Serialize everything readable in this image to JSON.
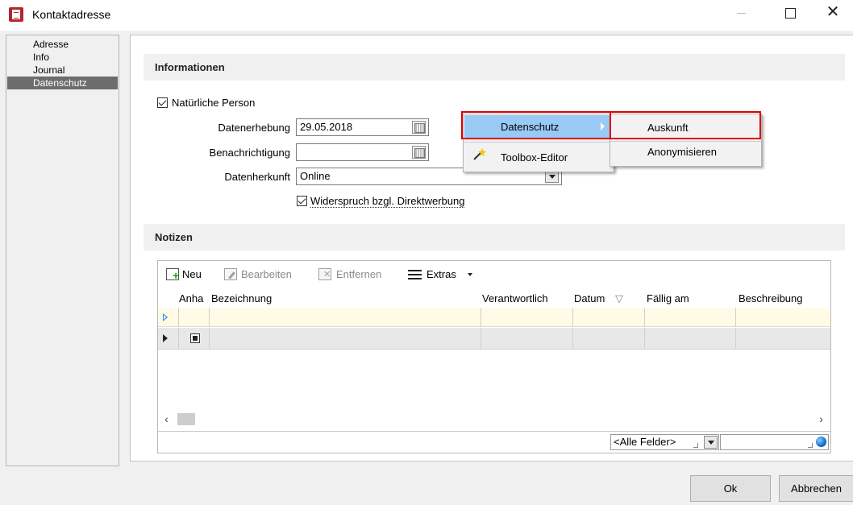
{
  "window": {
    "title": "Kontaktadresse",
    "minimize_label": "",
    "maximize_label": "",
    "close_label": "✕"
  },
  "nav": {
    "items": [
      {
        "label": "Adresse"
      },
      {
        "label": "Info"
      },
      {
        "label": "Journal"
      },
      {
        "label": "Datenschutz",
        "active": true
      }
    ]
  },
  "info_section": {
    "header": "Informationen",
    "natural_person_label": "Natürliche Person",
    "natural_person_checked": true,
    "data_collection_label": "Datenerhebung",
    "data_collection_value": "29.05.2018",
    "notification_label": "Benachrichtigung",
    "notification_value": "",
    "data_origin_label": "Datenherkunft",
    "data_origin_value": "Online",
    "objection_label": "Widerspruch bzgl. Direktwerbung",
    "objection_checked": true
  },
  "context_menu": {
    "items": [
      {
        "label": "Datenschutz",
        "highlighted": true,
        "has_submenu": true
      },
      {
        "label": "Toolbox-Editor",
        "icon": "magic-wand-icon"
      }
    ],
    "submenu": [
      {
        "label": "Auskunft",
        "highlighted": true
      },
      {
        "label": "Anonymisieren"
      }
    ],
    "highlight_color": "#e00000",
    "selection_color": "#99c9f5"
  },
  "notes_section": {
    "header": "Notizen",
    "toolbar": {
      "new_label": "Neu",
      "edit_label": "Bearbeiten",
      "remove_label": "Entfernen",
      "extras_label": "Extras"
    },
    "columns": [
      "Anha",
      "Bezeichnung",
      "Verantwortlich",
      "Datum",
      "Fällig am",
      "Beschreibung"
    ],
    "sort_indicator": "▽",
    "filter_field": "<Alle Felder>",
    "filter_value": ""
  },
  "buttons": {
    "ok": "Ok",
    "cancel": "Abbrechen"
  }
}
